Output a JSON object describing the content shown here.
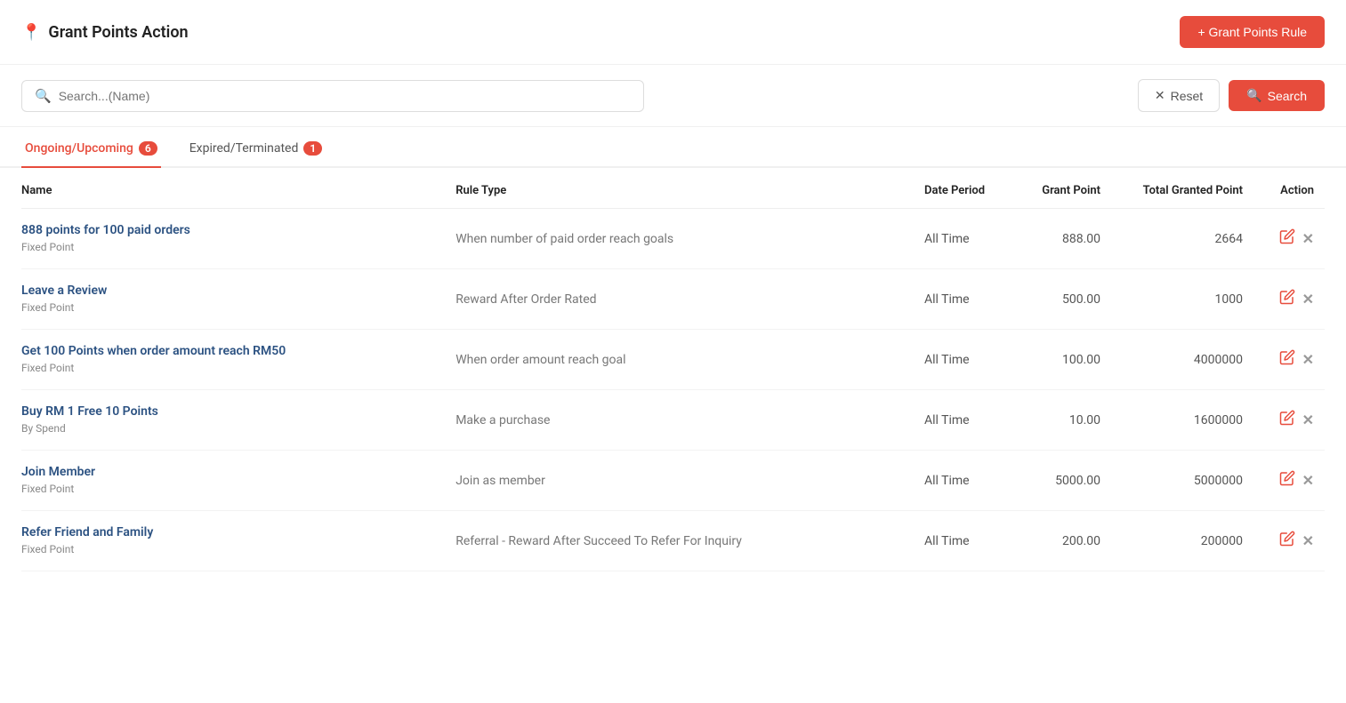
{
  "page": {
    "title": "Grant Points Action",
    "add_rule_label": "+ Grant Points Rule"
  },
  "search": {
    "placeholder": "Search...(Name)",
    "reset_label": "Reset",
    "search_label": "Search"
  },
  "tabs": [
    {
      "id": "ongoing",
      "label": "Ongoing/Upcoming",
      "badge": "6",
      "active": true
    },
    {
      "id": "expired",
      "label": "Expired/Terminated",
      "badge": "1",
      "active": false
    }
  ],
  "table": {
    "columns": [
      {
        "id": "name",
        "label": "Name"
      },
      {
        "id": "rule_type",
        "label": "Rule Type"
      },
      {
        "id": "date_period",
        "label": "Date Period"
      },
      {
        "id": "grant_point",
        "label": "Grant Point"
      },
      {
        "id": "total_granted_point",
        "label": "Total Granted Point"
      },
      {
        "id": "action",
        "label": "Action"
      }
    ],
    "rows": [
      {
        "name": "888 points for 100 paid orders",
        "subtype": "Fixed Point",
        "rule_type": "When number of paid order reach goals",
        "date_period": "All Time",
        "grant_point": "888.00",
        "total_granted_point": "2664"
      },
      {
        "name": "Leave a Review",
        "subtype": "Fixed Point",
        "rule_type": "Reward After Order Rated",
        "date_period": "All Time",
        "grant_point": "500.00",
        "total_granted_point": "1000"
      },
      {
        "name": "Get 100 Points when order amount reach RM50",
        "subtype": "Fixed Point",
        "rule_type": "When order amount reach goal",
        "date_period": "All Time",
        "grant_point": "100.00",
        "total_granted_point": "4000000"
      },
      {
        "name": "Buy RM 1 Free 10 Points",
        "subtype": "By Spend",
        "rule_type": "Make a purchase",
        "date_period": "All Time",
        "grant_point": "10.00",
        "total_granted_point": "1600000"
      },
      {
        "name": "Join Member",
        "subtype": "Fixed Point",
        "rule_type": "Join as member",
        "date_period": "All Time",
        "grant_point": "5000.00",
        "total_granted_point": "5000000"
      },
      {
        "name": "Refer Friend and Family",
        "subtype": "Fixed Point",
        "rule_type": "Referral - Reward After Succeed To Refer For Inquiry",
        "date_period": "All Time",
        "grant_point": "200.00",
        "total_granted_point": "200000"
      }
    ]
  }
}
